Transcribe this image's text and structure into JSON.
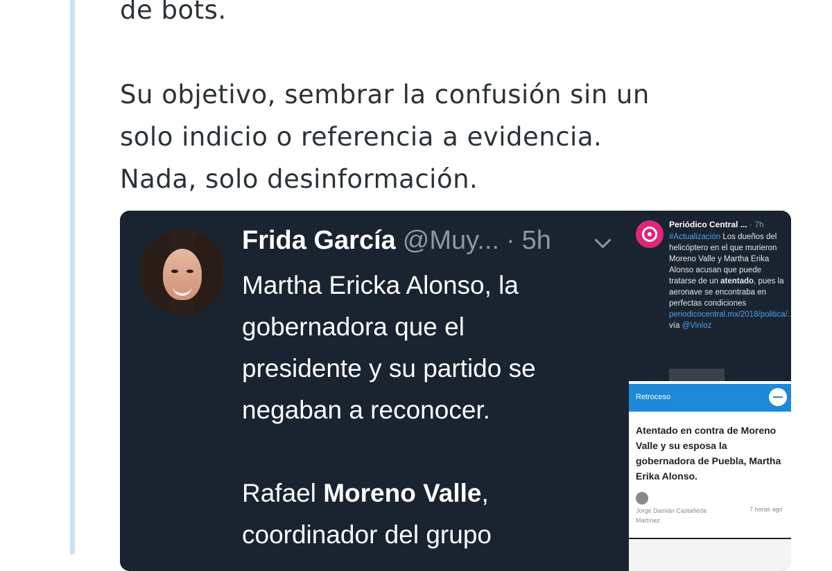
{
  "tweet": {
    "lines": [
      "de bots.",
      "Su objetivo, sembrar la confusión sin un",
      "solo indicio o referencia a evidencia.",
      "Nada, solo desinformación."
    ]
  },
  "embedded_tweet": {
    "name": "Frida García",
    "handle": "@Muy...",
    "separator": "·",
    "time": "5h",
    "body_lines": [
      "Martha Ericka Alonso, la",
      "gobernadora que el",
      "presidente y su partido se",
      "negaban a reconocer."
    ],
    "body2_prefix": "Rafael ",
    "body2_bold": "Moreno Valle",
    "body2_suffix": ",",
    "body2_line2": "coordinador del grupo"
  },
  "side_tweet": {
    "name": "Periódico Central ...",
    "time": "· 7h",
    "hashtag": "#Actualización",
    "text1": " Los dueños del helicóptero en el que murieron Moreno Valle y Martha Erika Alonso acusan que puede tratarse de un ",
    "bold": "atentado",
    "text2": ", pues la aeronave se encontraba en perfectas condiciones ",
    "link": "periodicocentral.mx/2018/politica/...",
    "via": " vía ",
    "mention": "@Vinloz"
  },
  "side_article": {
    "bar_label": "Retroceso",
    "title": "Atentado en contra de Moreno Valle y su esposa la gobernadora de Puebla, Martha Erika Alonso.",
    "author": "Jorge Damián Castañeda Martínez",
    "ago": "7 horas ago"
  },
  "colors": {
    "thread_line": "#c9e3f3",
    "dark_bg": "#1a2330",
    "accent_blue": "#1e89d6",
    "link_blue": "#4aa3ee",
    "logo_pink": "#e0267a"
  }
}
